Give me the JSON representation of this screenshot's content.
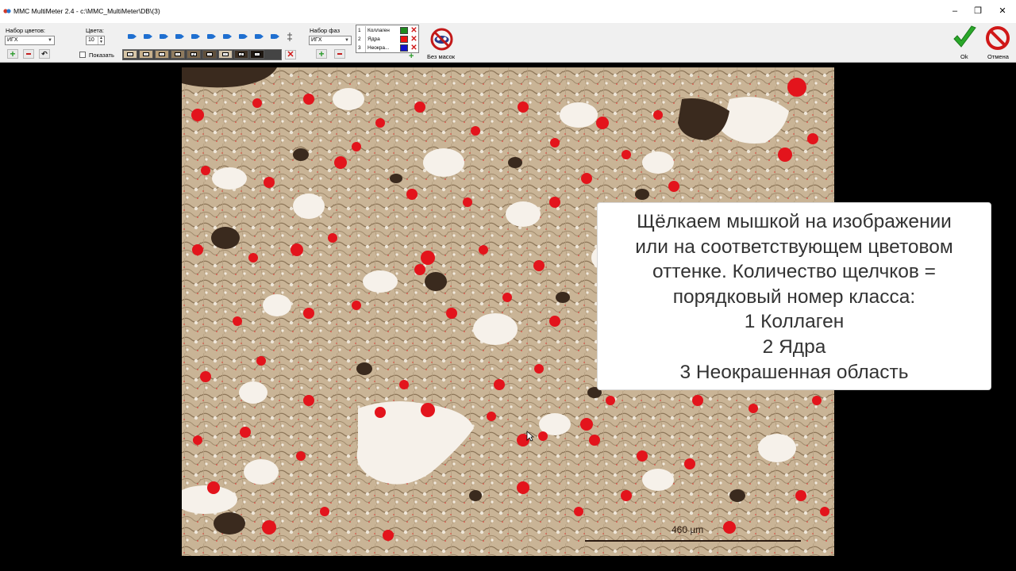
{
  "window": {
    "title": "MMC MultiMeter 2.4 - c:\\MMC_MultiMeter\\DB\\(3)",
    "minimize": "–",
    "restore": "❐",
    "close": "✕"
  },
  "toolbar": {
    "palette_set_label": "Набор цветов:",
    "palette_set_value": "ИГХ",
    "colors_label": "Цвета:",
    "colors_value": "10",
    "show_label": "Показать",
    "phase_set_label": "Набор фаз",
    "phase_set_value": "ИГХ",
    "no_masks_label": "Без масок",
    "ok_label": "Ok",
    "cancel_label": "Отмена",
    "swatches": [
      {
        "color": "#d8c7a8",
        "mark": "-"
      },
      {
        "color": "#c6b08c",
        "mark": "-"
      },
      {
        "color": "#b79e78",
        "mark": "-"
      },
      {
        "color": "#8f7b5f",
        "mark": "-"
      },
      {
        "color": "#7a664c",
        "mark": "2"
      },
      {
        "color": "#5f4f3b",
        "mark": "-"
      },
      {
        "color": "#d2c2a8",
        "mark": "-"
      },
      {
        "color": "#3b2e22",
        "mark": "2"
      },
      {
        "color": "#1e1711",
        "mark": "-"
      }
    ]
  },
  "phases": [
    {
      "num": "1",
      "name": "Коллаген",
      "color": "#1f8a1f"
    },
    {
      "num": "2",
      "name": "Ядра",
      "color": "#ee1111"
    },
    {
      "num": "3",
      "name": "Неокра...",
      "color": "#1111cc"
    }
  ],
  "image": {
    "scale_label": "460 µm"
  },
  "caption": {
    "lines": [
      "Щёлкаем мышкой на изображении",
      "или на соответствующем цветовом",
      "оттенке. Количество щелчков =",
      "порядковый номер класса:",
      "1 Коллаген",
      "2 Ядра",
      "3 Неокрашенная область"
    ]
  },
  "colors": {
    "accent_blue": "#1f6fd0",
    "red_mask": "#e3141c",
    "ok_green": "#2aa82a",
    "cancel_red": "#d01818"
  }
}
